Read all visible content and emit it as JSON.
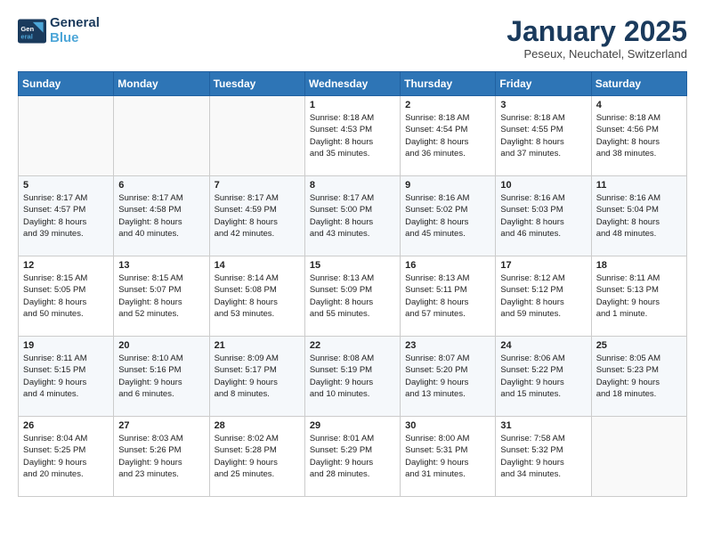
{
  "header": {
    "logo_general": "General",
    "logo_blue": "Blue",
    "month": "January 2025",
    "location": "Peseux, Neuchatel, Switzerland"
  },
  "days_of_week": [
    "Sunday",
    "Monday",
    "Tuesday",
    "Wednesday",
    "Thursday",
    "Friday",
    "Saturday"
  ],
  "weeks": [
    [
      {
        "day": "",
        "info": ""
      },
      {
        "day": "",
        "info": ""
      },
      {
        "day": "",
        "info": ""
      },
      {
        "day": "1",
        "info": "Sunrise: 8:18 AM\nSunset: 4:53 PM\nDaylight: 8 hours\nand 35 minutes."
      },
      {
        "day": "2",
        "info": "Sunrise: 8:18 AM\nSunset: 4:54 PM\nDaylight: 8 hours\nand 36 minutes."
      },
      {
        "day": "3",
        "info": "Sunrise: 8:18 AM\nSunset: 4:55 PM\nDaylight: 8 hours\nand 37 minutes."
      },
      {
        "day": "4",
        "info": "Sunrise: 8:18 AM\nSunset: 4:56 PM\nDaylight: 8 hours\nand 38 minutes."
      }
    ],
    [
      {
        "day": "5",
        "info": "Sunrise: 8:17 AM\nSunset: 4:57 PM\nDaylight: 8 hours\nand 39 minutes."
      },
      {
        "day": "6",
        "info": "Sunrise: 8:17 AM\nSunset: 4:58 PM\nDaylight: 8 hours\nand 40 minutes."
      },
      {
        "day": "7",
        "info": "Sunrise: 8:17 AM\nSunset: 4:59 PM\nDaylight: 8 hours\nand 42 minutes."
      },
      {
        "day": "8",
        "info": "Sunrise: 8:17 AM\nSunset: 5:00 PM\nDaylight: 8 hours\nand 43 minutes."
      },
      {
        "day": "9",
        "info": "Sunrise: 8:16 AM\nSunset: 5:02 PM\nDaylight: 8 hours\nand 45 minutes."
      },
      {
        "day": "10",
        "info": "Sunrise: 8:16 AM\nSunset: 5:03 PM\nDaylight: 8 hours\nand 46 minutes."
      },
      {
        "day": "11",
        "info": "Sunrise: 8:16 AM\nSunset: 5:04 PM\nDaylight: 8 hours\nand 48 minutes."
      }
    ],
    [
      {
        "day": "12",
        "info": "Sunrise: 8:15 AM\nSunset: 5:05 PM\nDaylight: 8 hours\nand 50 minutes."
      },
      {
        "day": "13",
        "info": "Sunrise: 8:15 AM\nSunset: 5:07 PM\nDaylight: 8 hours\nand 52 minutes."
      },
      {
        "day": "14",
        "info": "Sunrise: 8:14 AM\nSunset: 5:08 PM\nDaylight: 8 hours\nand 53 minutes."
      },
      {
        "day": "15",
        "info": "Sunrise: 8:13 AM\nSunset: 5:09 PM\nDaylight: 8 hours\nand 55 minutes."
      },
      {
        "day": "16",
        "info": "Sunrise: 8:13 AM\nSunset: 5:11 PM\nDaylight: 8 hours\nand 57 minutes."
      },
      {
        "day": "17",
        "info": "Sunrise: 8:12 AM\nSunset: 5:12 PM\nDaylight: 8 hours\nand 59 minutes."
      },
      {
        "day": "18",
        "info": "Sunrise: 8:11 AM\nSunset: 5:13 PM\nDaylight: 9 hours\nand 1 minute."
      }
    ],
    [
      {
        "day": "19",
        "info": "Sunrise: 8:11 AM\nSunset: 5:15 PM\nDaylight: 9 hours\nand 4 minutes."
      },
      {
        "day": "20",
        "info": "Sunrise: 8:10 AM\nSunset: 5:16 PM\nDaylight: 9 hours\nand 6 minutes."
      },
      {
        "day": "21",
        "info": "Sunrise: 8:09 AM\nSunset: 5:17 PM\nDaylight: 9 hours\nand 8 minutes."
      },
      {
        "day": "22",
        "info": "Sunrise: 8:08 AM\nSunset: 5:19 PM\nDaylight: 9 hours\nand 10 minutes."
      },
      {
        "day": "23",
        "info": "Sunrise: 8:07 AM\nSunset: 5:20 PM\nDaylight: 9 hours\nand 13 minutes."
      },
      {
        "day": "24",
        "info": "Sunrise: 8:06 AM\nSunset: 5:22 PM\nDaylight: 9 hours\nand 15 minutes."
      },
      {
        "day": "25",
        "info": "Sunrise: 8:05 AM\nSunset: 5:23 PM\nDaylight: 9 hours\nand 18 minutes."
      }
    ],
    [
      {
        "day": "26",
        "info": "Sunrise: 8:04 AM\nSunset: 5:25 PM\nDaylight: 9 hours\nand 20 minutes."
      },
      {
        "day": "27",
        "info": "Sunrise: 8:03 AM\nSunset: 5:26 PM\nDaylight: 9 hours\nand 23 minutes."
      },
      {
        "day": "28",
        "info": "Sunrise: 8:02 AM\nSunset: 5:28 PM\nDaylight: 9 hours\nand 25 minutes."
      },
      {
        "day": "29",
        "info": "Sunrise: 8:01 AM\nSunset: 5:29 PM\nDaylight: 9 hours\nand 28 minutes."
      },
      {
        "day": "30",
        "info": "Sunrise: 8:00 AM\nSunset: 5:31 PM\nDaylight: 9 hours\nand 31 minutes."
      },
      {
        "day": "31",
        "info": "Sunrise: 7:58 AM\nSunset: 5:32 PM\nDaylight: 9 hours\nand 34 minutes."
      },
      {
        "day": "",
        "info": ""
      }
    ]
  ]
}
